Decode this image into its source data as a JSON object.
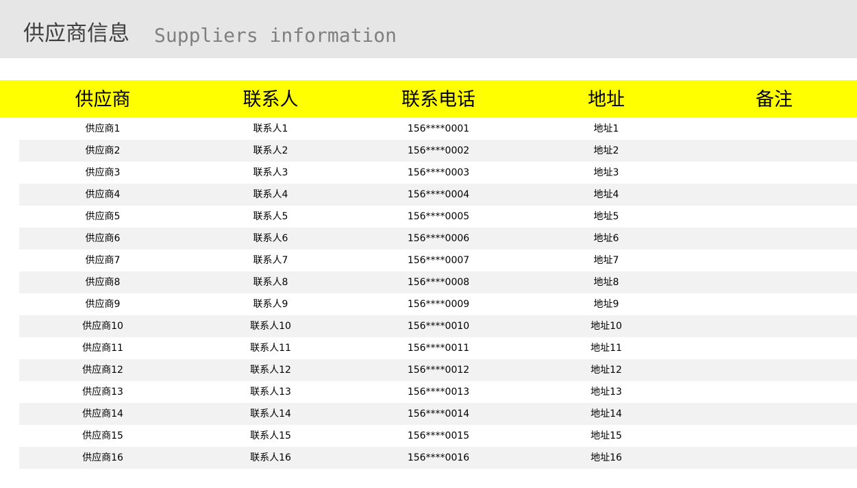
{
  "header": {
    "title_cn": "供应商信息",
    "title_en": "Suppliers information",
    "background": "#e6e6e6"
  },
  "table": {
    "header_background": "#ffff00",
    "stripe_color": "#f2f2f2",
    "columns": [
      "供应商",
      "联系人",
      "联系电话",
      "地址",
      "备注"
    ],
    "rows": [
      [
        "供应商1",
        "联系人1",
        "156****0001",
        "地址1",
        ""
      ],
      [
        "供应商2",
        "联系人2",
        "156****0002",
        "地址2",
        ""
      ],
      [
        "供应商3",
        "联系人3",
        "156****0003",
        "地址3",
        ""
      ],
      [
        "供应商4",
        "联系人4",
        "156****0004",
        "地址4",
        ""
      ],
      [
        "供应商5",
        "联系人5",
        "156****0005",
        "地址5",
        ""
      ],
      [
        "供应商6",
        "联系人6",
        "156****0006",
        "地址6",
        ""
      ],
      [
        "供应商7",
        "联系人7",
        "156****0007",
        "地址7",
        ""
      ],
      [
        "供应商8",
        "联系人8",
        "156****0008",
        "地址8",
        ""
      ],
      [
        "供应商9",
        "联系人9",
        "156****0009",
        "地址9",
        ""
      ],
      [
        "供应商10",
        "联系人10",
        "156****0010",
        "地址10",
        ""
      ],
      [
        "供应商11",
        "联系人11",
        "156****0011",
        "地址11",
        ""
      ],
      [
        "供应商12",
        "联系人12",
        "156****0012",
        "地址12",
        ""
      ],
      [
        "供应商13",
        "联系人13",
        "156****0013",
        "地址13",
        ""
      ],
      [
        "供应商14",
        "联系人14",
        "156****0014",
        "地址14",
        ""
      ],
      [
        "供应商15",
        "联系人15",
        "156****0015",
        "地址15",
        ""
      ],
      [
        "供应商16",
        "联系人16",
        "156****0016",
        "地址16",
        ""
      ]
    ]
  }
}
